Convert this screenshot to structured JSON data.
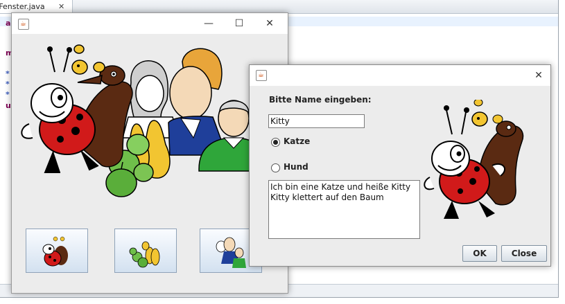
{
  "ide": {
    "tab_label": "tFenster.java",
    "tab_close": "✕",
    "gutter": [
      "a",
      "m",
      "*",
      "*",
      "*",
      "u"
    ]
  },
  "main_window": {
    "minimize": "—",
    "maximize": "☐",
    "close": "✕",
    "icon": "java-icon",
    "buttons": [
      {
        "name": "ladybug-button",
        "icon": "ladybug-and-dog-icon"
      },
      {
        "name": "fruit-button",
        "icon": "apples-and-pears-icon"
      },
      {
        "name": "people-button",
        "icon": "family-icon"
      }
    ]
  },
  "dialog": {
    "icon": "java-icon",
    "close": "✕",
    "prompt_label": "Bitte Name eingeben:",
    "name_value": "Kitty",
    "radio_cat_label": "Katze",
    "radio_dog_label": "Hund",
    "selected": "Katze",
    "text_lines": [
      "Ich bin eine Katze und heiße Kitty",
      "Kitty klettert auf den Baum"
    ],
    "ok_label": "OK",
    "close_label": "Close"
  },
  "colors": {
    "button_border": "#8ea2b8",
    "ladybug_red": "#d11a1a",
    "dog_brown": "#5a2a12",
    "apple_green": "#6fbf4a",
    "pear_yellow": "#f2c531",
    "jacket_blue": "#1f3f9a",
    "shirt_green": "#2fa63a"
  }
}
